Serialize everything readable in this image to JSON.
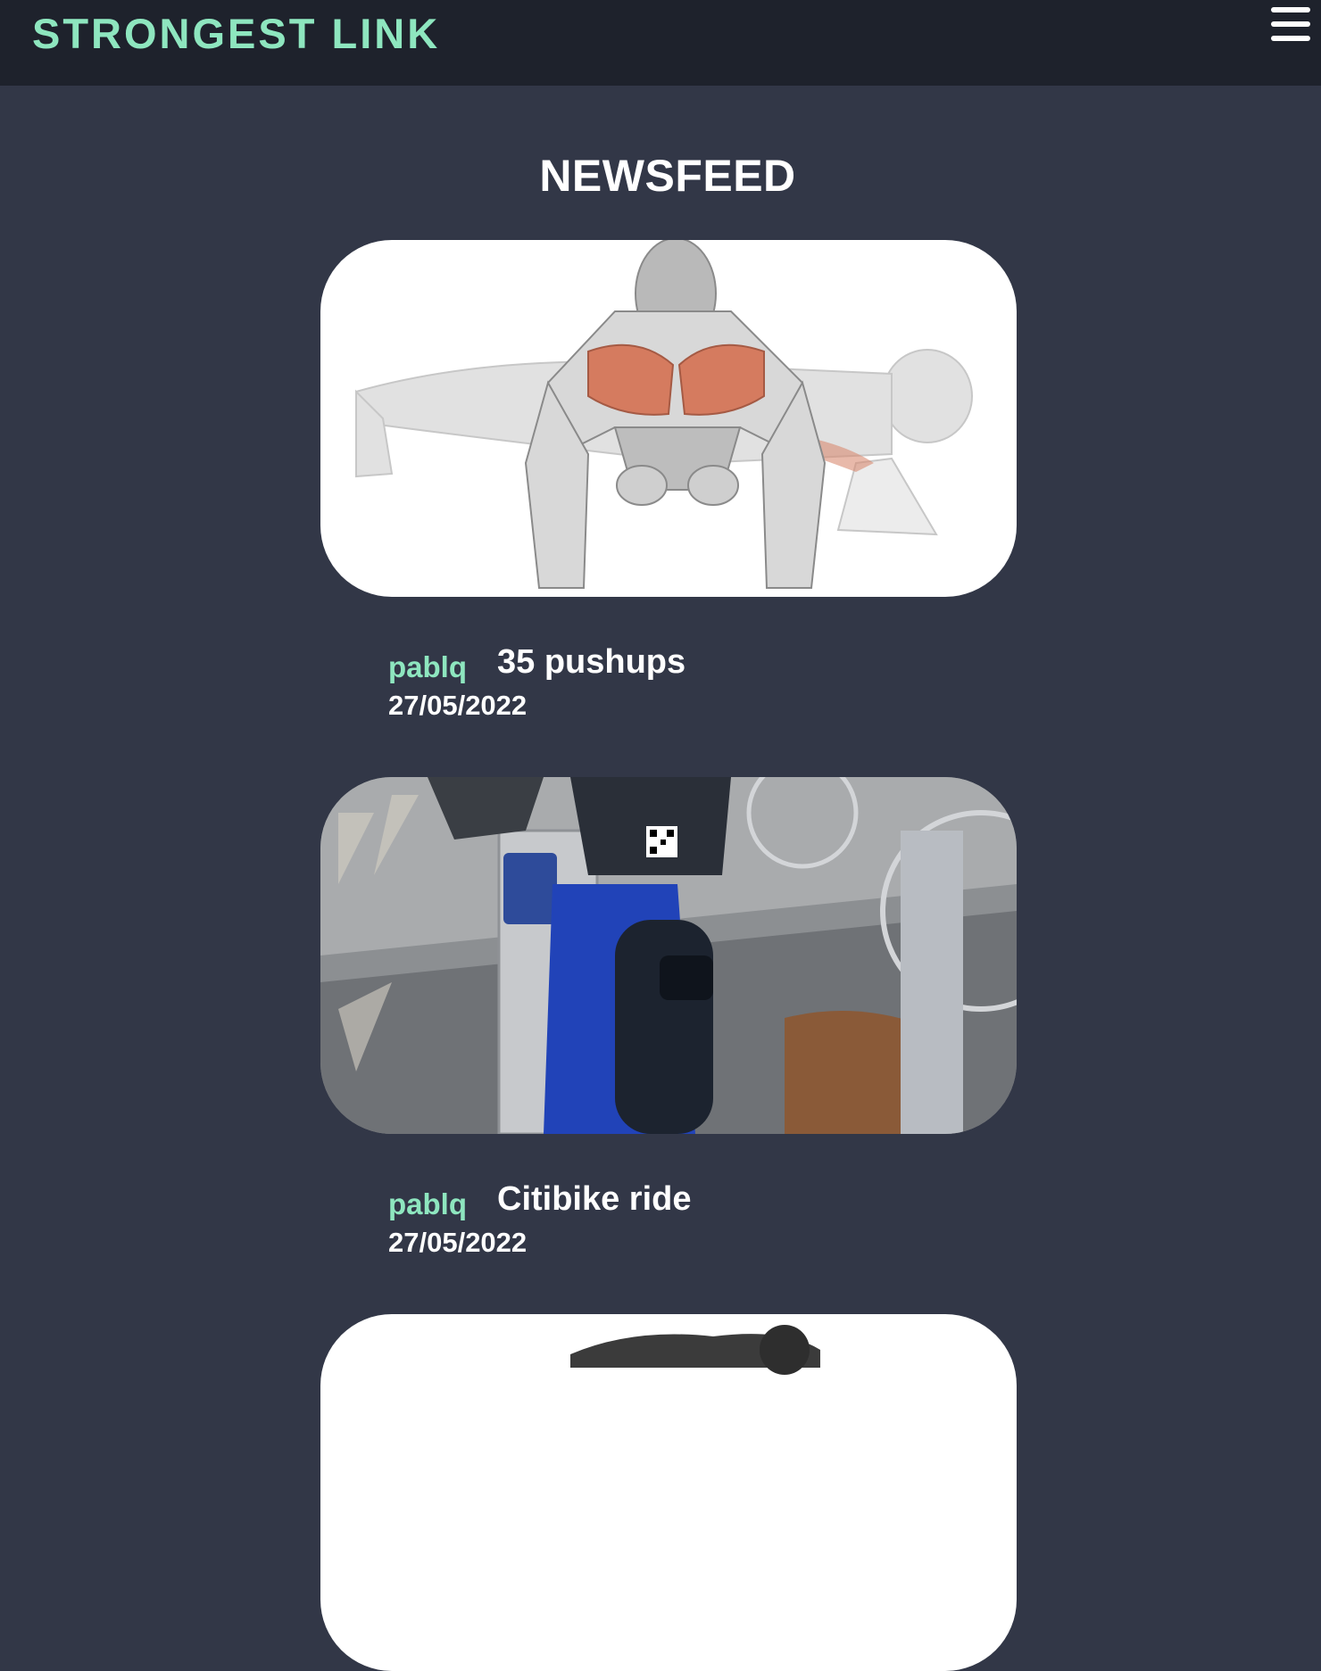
{
  "app": {
    "logo_text": "STRONGEST LINK",
    "brand_color": "#8ee6bf"
  },
  "header": {
    "menu_icon": "hamburger-menu-icon"
  },
  "page": {
    "title": "NEWSFEED"
  },
  "posts": [
    {
      "user": "pablq",
      "text": "35 pushups",
      "date": "27/05/2022",
      "image": "pushup-anatomy-illustration"
    },
    {
      "user": "pablq",
      "text": "Citibike ride",
      "date": "27/05/2022",
      "image": "citibike-photo"
    },
    {
      "image": "exercise-illustration-partial"
    }
  ]
}
